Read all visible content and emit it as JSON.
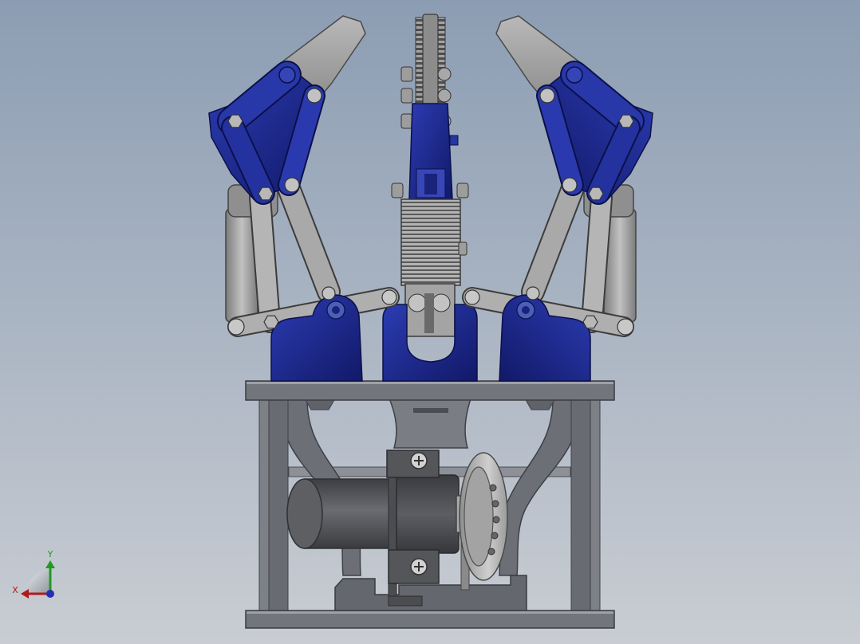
{
  "viewport": {
    "background_top": "#8c9db3",
    "background_bottom": "#c9cdd3"
  },
  "model": {
    "blue_light": "#2c3cb2",
    "blue_dark": "#111968",
    "grey_light": "#c2c2c2",
    "grey_dark": "#7c7c7c",
    "frame_color": "#6f727a"
  },
  "triad": {
    "icon": "view-orientation-triad-icon",
    "x_label": "X",
    "y_label": "Y",
    "x_color": "#b3191b",
    "y_color": "#1f9a22",
    "z_color": "#2230b0"
  }
}
